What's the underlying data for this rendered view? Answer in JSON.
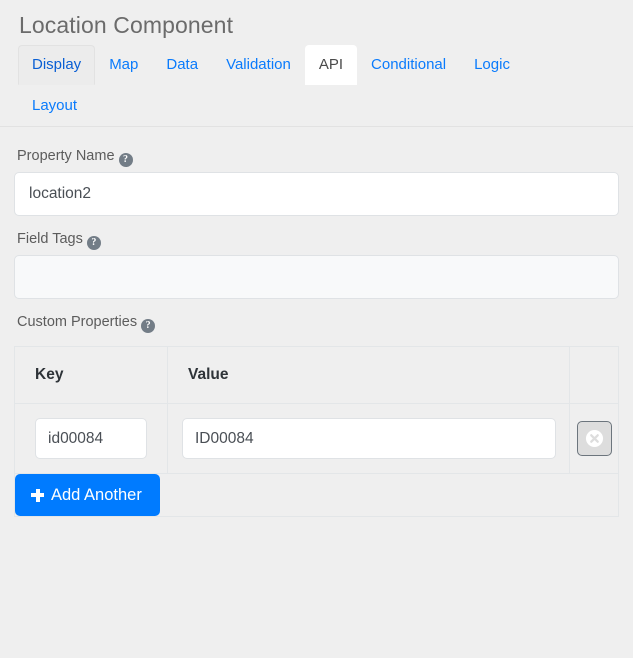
{
  "header": {
    "title": "Location Component"
  },
  "tabs": {
    "items": [
      {
        "label": "Display",
        "state": "hover"
      },
      {
        "label": "Map",
        "state": "normal"
      },
      {
        "label": "Data",
        "state": "normal"
      },
      {
        "label": "Validation",
        "state": "normal"
      },
      {
        "label": "API",
        "state": "active"
      },
      {
        "label": "Conditional",
        "state": "normal"
      },
      {
        "label": "Logic",
        "state": "normal"
      },
      {
        "label": "Layout",
        "state": "normal"
      }
    ],
    "active": "API"
  },
  "fields": {
    "property_name": {
      "label": "Property Name",
      "help": "?",
      "value": "location2",
      "placeholder": ""
    },
    "field_tags": {
      "label": "Field Tags",
      "help": "?",
      "value": "",
      "placeholder": ""
    },
    "custom_properties": {
      "label": "Custom Properties",
      "help": "?",
      "columns": [
        "Key",
        "Value",
        ""
      ],
      "rows": [
        {
          "key": "id00084",
          "value": "ID00084",
          "remove_title": "Remove"
        }
      ],
      "add_button": "Add Another"
    }
  },
  "icons": {
    "help": "question-circle-icon",
    "remove": "times-circle-icon",
    "add": "plus-icon"
  },
  "colors": {
    "accent": "#007bff",
    "link": "#0a7bfc",
    "page_bg": "#efefef",
    "border": "#e3e6e8",
    "text": "#4a4f55"
  }
}
